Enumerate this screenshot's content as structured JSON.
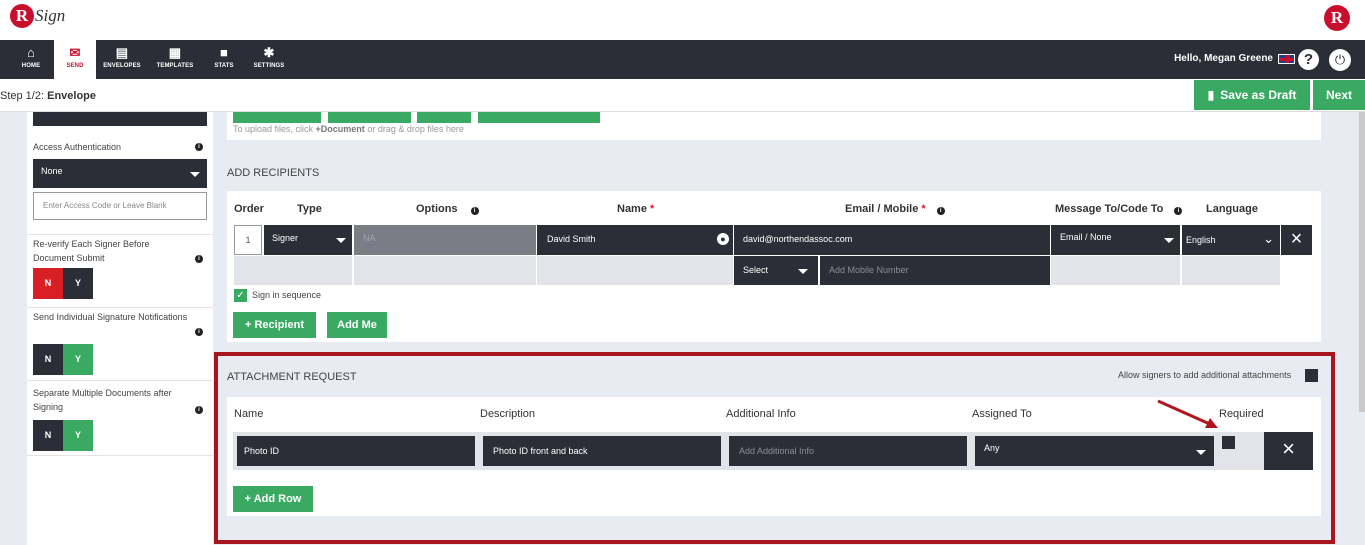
{
  "brand": {
    "logo_text": "Sign",
    "logo_initial": "R",
    "right_initial": "R"
  },
  "nav": {
    "items": [
      {
        "label": "HOME",
        "icon": "home-icon",
        "glyph": "⌂"
      },
      {
        "label": "SEND",
        "icon": "envelope-icon",
        "glyph": "✉"
      },
      {
        "label": "ENVELOPES",
        "icon": "inbox-icon",
        "glyph": "▤"
      },
      {
        "label": "TEMPLATES",
        "icon": "templates-icon",
        "glyph": "▦"
      },
      {
        "label": "STATS",
        "icon": "briefcase-icon",
        "glyph": "■"
      },
      {
        "label": "SETTINGS",
        "icon": "gear-icon",
        "glyph": "✱"
      }
    ],
    "greeting": "Hello, Megan Greene",
    "help_glyph": "?",
    "power_glyph": "⏻"
  },
  "step": {
    "prefix": "Step 1/2:",
    "name": "Envelope"
  },
  "actions": {
    "save_draft": "Save as Draft",
    "next": "Next",
    "draft_glyph": "▮"
  },
  "sidebar": {
    "access_auth_label": "Access Authentication",
    "access_auth_value": "None",
    "access_code_placeholder": "Enter Access Code or Leave Blank",
    "reverify_label": "Re-verify Each Signer Before Document Submit",
    "individual_notif_label": "Send Individual Signature Notifications",
    "separate_docs_label": "Separate Multiple Documents after Signing",
    "no": "N",
    "yes": "Y"
  },
  "upload_hint_prefix": "To upload files, click ",
  "upload_hint_bold": "+Document",
  "upload_hint_suffix": " or drag & drop files here",
  "recipients": {
    "title": "ADD RECIPIENTS",
    "cols": {
      "order": "Order",
      "type": "Type",
      "options": "Options",
      "name": "Name",
      "email": "Email / Mobile",
      "message": "Message To/Code To",
      "language": "Language"
    },
    "required_mark": "*",
    "row": {
      "order": "1",
      "type": "Signer",
      "options": "NA",
      "name": "David Smith",
      "email": "david@northendassoc.com",
      "message": "Email / None",
      "language": "English",
      "mobile_select": "Select",
      "mobile_placeholder": "Add Mobile Number"
    },
    "sequence_label": "Sign in sequence",
    "add_recipient": "+ Recipient",
    "add_me": "Add Me"
  },
  "attachments": {
    "title": "ATTACHMENT REQUEST",
    "allow_label": "Allow signers to add additional attachments",
    "cols": {
      "name": "Name",
      "description": "Description",
      "additional": "Additional Info",
      "assigned": "Assigned To",
      "required": "Required"
    },
    "row": {
      "name": "Photo ID",
      "description": "Photo ID front and back",
      "additional_placeholder": "Add Additional Info",
      "assigned": "Any"
    },
    "add_row": "+ Add Row"
  },
  "colors": {
    "accent_green": "#3aaa63",
    "dark": "#2b2e37",
    "brand_red": "#c8102e",
    "highlight": "#a8161d"
  }
}
